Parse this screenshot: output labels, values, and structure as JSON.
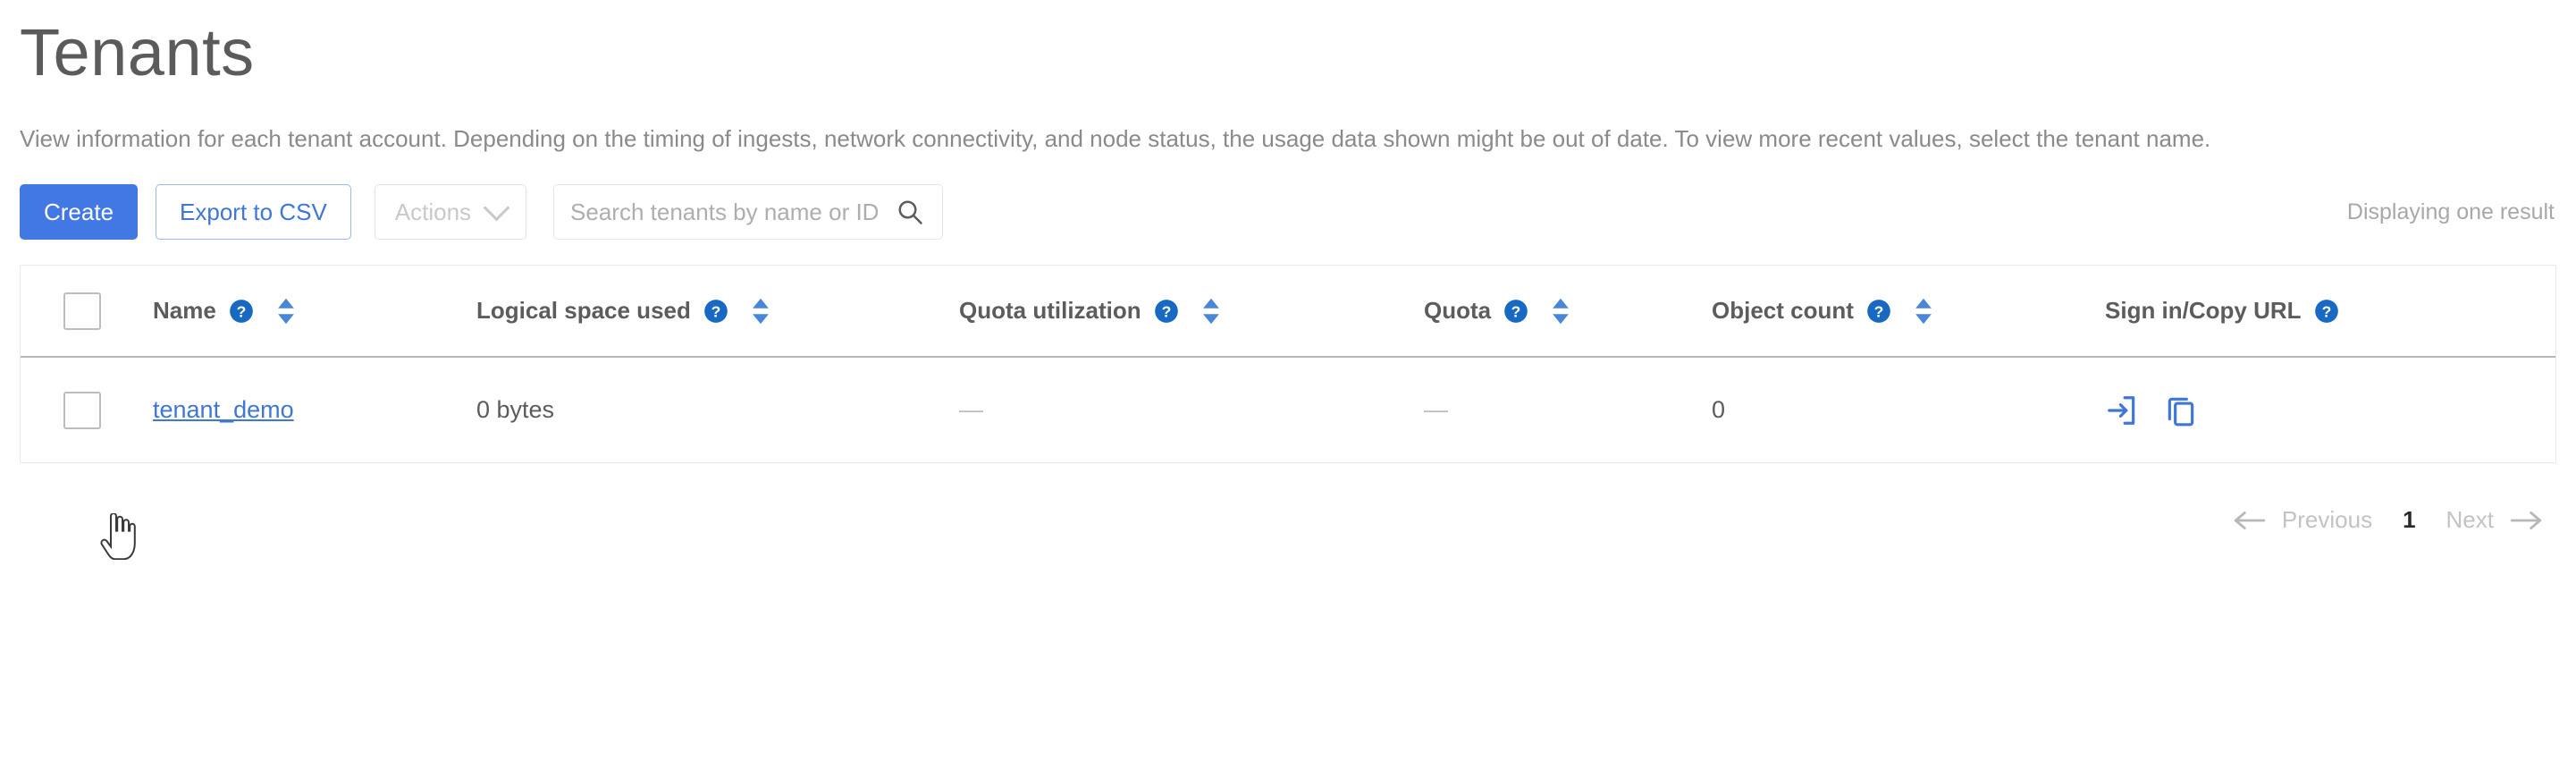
{
  "page": {
    "title": "Tenants",
    "description": "View information for each tenant account. Depending on the timing of ingests, network connectivity, and node status, the usage data shown might be out of date. To view more recent values, select the tenant name."
  },
  "toolbar": {
    "create_label": "Create",
    "export_label": "Export to CSV",
    "actions_label": "Actions",
    "actions_chevron_icon": "chevron-down-icon",
    "search_placeholder": "Search tenants by name or ID",
    "search_value": "",
    "search_icon": "search-icon",
    "result_count": "Displaying one result"
  },
  "table": {
    "columns": [
      {
        "label": "",
        "help": false,
        "sortable": false,
        "icon": "checkbox-icon"
      },
      {
        "label": "Name",
        "help": true,
        "sortable": true
      },
      {
        "label": "Logical space used",
        "help": true,
        "sortable": true
      },
      {
        "label": "Quota utilization",
        "help": true,
        "sortable": true
      },
      {
        "label": "Quota",
        "help": true,
        "sortable": true
      },
      {
        "label": "Object count",
        "help": true,
        "sortable": true
      },
      {
        "label": "Sign in/Copy URL",
        "help": true,
        "sortable": false
      }
    ],
    "rows": [
      {
        "selected": false,
        "name": "tenant_demo",
        "logical_space_used": "0 bytes",
        "quota_utilization": "—",
        "quota": "—",
        "object_count": "0",
        "sign_in_icon": "sign-in-icon",
        "copy_url_icon": "copy-icon"
      }
    ]
  },
  "pagination": {
    "previous_label": "Previous",
    "current_page": "1",
    "next_label": "Next",
    "prev_arrow_icon": "arrow-left-icon",
    "next_arrow_icon": "arrow-right-icon"
  },
  "colors": {
    "primary_blue": "#4278e4",
    "link_blue": "#3f76da",
    "help_blue": "#1769c4",
    "title_gray": "#5b5b5b",
    "muted_gray": "#a8a8a8"
  }
}
